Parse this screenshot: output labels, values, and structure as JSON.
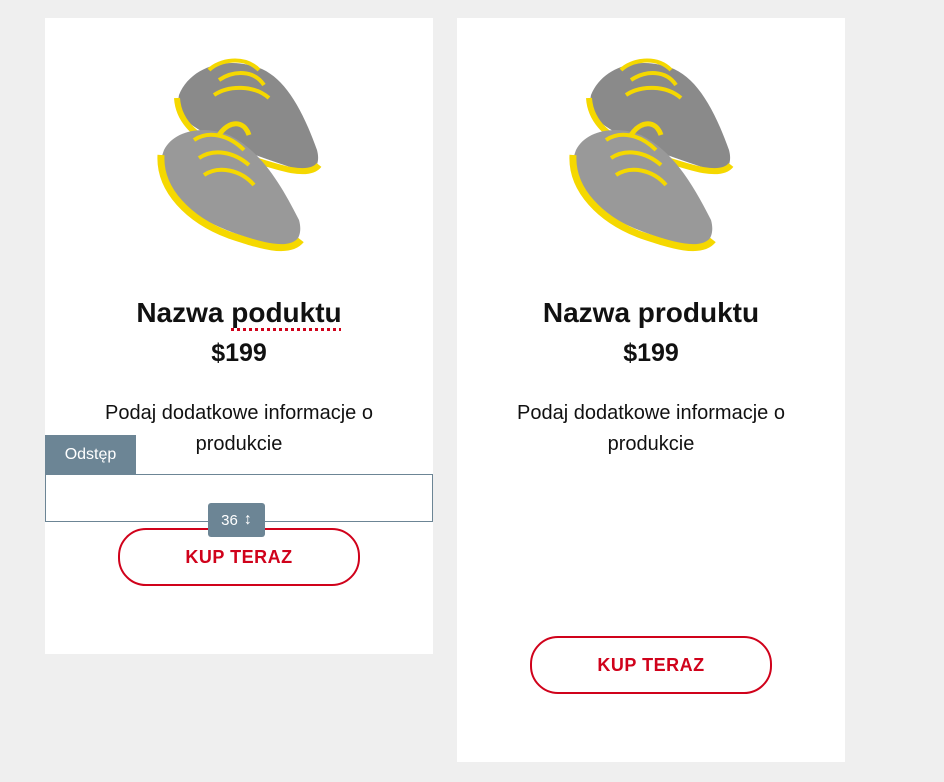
{
  "products": [
    {
      "title_word1": "Nazwa",
      "title_word2": "poduktu",
      "price": "$199",
      "description": "Podaj dodatkowe informacje o produkcie",
      "button_label": "KUP TERAZ"
    },
    {
      "title": "Nazwa produktu",
      "price": "$199",
      "description": "Podaj dodatkowe informacje o produkcie",
      "button_label": "KUP TERAZ"
    }
  ],
  "spacer": {
    "label": "Odstęp",
    "value": "36",
    "handle_icon": "↕"
  },
  "colors": {
    "accent": "#d0021b",
    "editor": "#6c8595",
    "shoe_body": "#8a8a8a",
    "shoe_accent": "#f5d800"
  },
  "icons": {
    "product_image": "sneakers-image",
    "resize": "vertical-resize-icon"
  }
}
